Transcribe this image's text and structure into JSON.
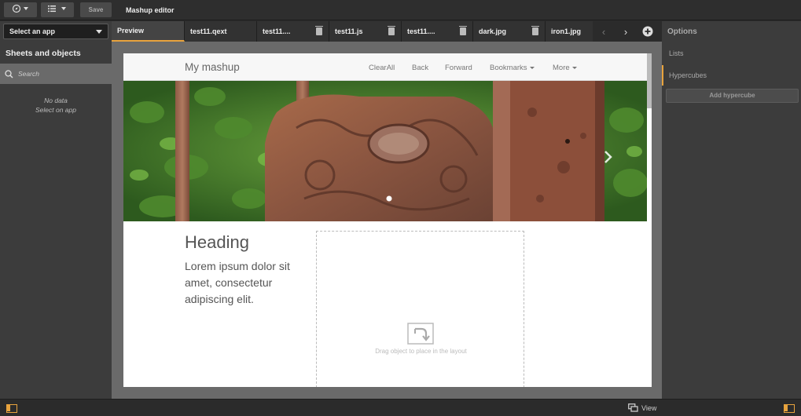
{
  "toolbar": {
    "save_label": "Save",
    "title": "Mashup editor"
  },
  "left_panel": {
    "select_app_label": "Select an app",
    "sheets_title": "Sheets and objects",
    "search_placeholder": "Search",
    "no_data": "No data",
    "select_on_app": "Select on app"
  },
  "tabs": [
    {
      "label": "Preview",
      "active": true,
      "deletable": false
    },
    {
      "label": "test11.qext",
      "active": false,
      "deletable": false
    },
    {
      "label": "test11....",
      "active": false,
      "deletable": true
    },
    {
      "label": "test11.js",
      "active": false,
      "deletable": true
    },
    {
      "label": "test11....",
      "active": false,
      "deletable": true
    },
    {
      "label": "dark.jpg",
      "active": false,
      "deletable": true
    },
    {
      "label": "iron1.jpg",
      "active": false,
      "deletable": false
    }
  ],
  "preview": {
    "brand": "My mashup",
    "nav": {
      "clear_all": "ClearAll",
      "back": "Back",
      "forward": "Forward",
      "bookmarks": "Bookmarks",
      "more": "More"
    },
    "heading": "Heading",
    "lorem": "Lorem ipsum dolor sit amet, consectetur adipiscing elit.",
    "drop_hint": "Drag object to place in the layout"
  },
  "right_panel": {
    "title": "Options",
    "lists": "Lists",
    "hypercubes": "Hypercubes",
    "add_hypercube": "Add hypercube"
  },
  "bottom": {
    "view_label": "View"
  },
  "colors": {
    "accent": "#e8a33d",
    "panel": "#3c3c3c",
    "canvas": "#6a6a6a"
  }
}
